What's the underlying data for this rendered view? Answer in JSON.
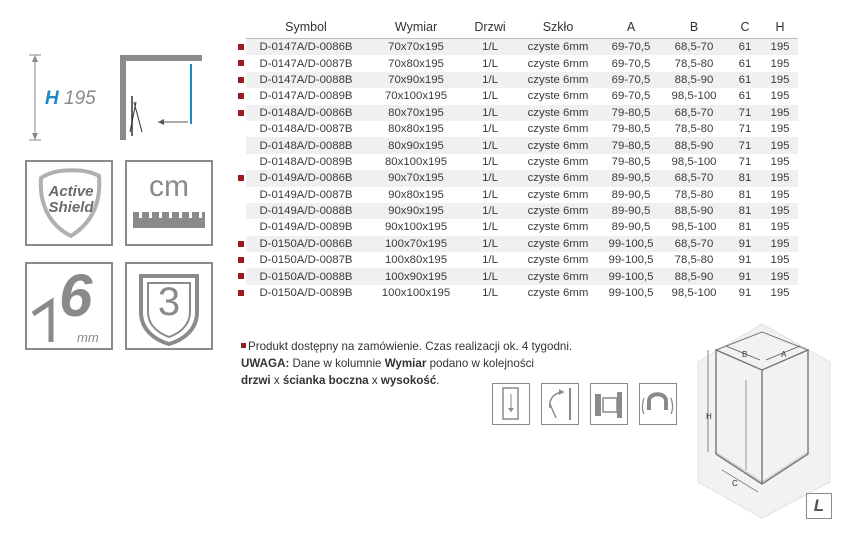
{
  "height_label": {
    "letter": "H",
    "value": "195"
  },
  "icons": {
    "active_shield": {
      "line1": "Active",
      "line2": "Shield"
    },
    "cm_label": "cm",
    "glass_thickness": {
      "number": "6",
      "unit": "mm"
    },
    "warranty_years": "3"
  },
  "table": {
    "headers": [
      "Symbol",
      "Wymiar",
      "Drzwi",
      "Szkło",
      "A",
      "B",
      "C",
      "H"
    ],
    "rows": [
      {
        "bullet": true,
        "cells": [
          "D-0147A/D-0086B",
          "70x70x195",
          "1/L",
          "czyste 6mm",
          "69-70,5",
          "68,5-70",
          "61",
          "195"
        ]
      },
      {
        "bullet": true,
        "cells": [
          "D-0147A/D-0087B",
          "70x80x195",
          "1/L",
          "czyste 6mm",
          "69-70,5",
          "78,5-80",
          "61",
          "195"
        ]
      },
      {
        "bullet": true,
        "cells": [
          "D-0147A/D-0088B",
          "70x90x195",
          "1/L",
          "czyste 6mm",
          "69-70,5",
          "88,5-90",
          "61",
          "195"
        ]
      },
      {
        "bullet": true,
        "cells": [
          "D-0147A/D-0089B",
          "70x100x195",
          "1/L",
          "czyste 6mm",
          "69-70,5",
          "98,5-100",
          "61",
          "195"
        ]
      },
      {
        "bullet": true,
        "cells": [
          "D-0148A/D-0086B",
          "80x70x195",
          "1/L",
          "czyste 6mm",
          "79-80,5",
          "68,5-70",
          "71",
          "195"
        ]
      },
      {
        "bullet": false,
        "cells": [
          "D-0148A/D-0087B",
          "80x80x195",
          "1/L",
          "czyste 6mm",
          "79-80,5",
          "78,5-80",
          "71",
          "195"
        ]
      },
      {
        "bullet": false,
        "cells": [
          "D-0148A/D-0088B",
          "80x90x195",
          "1/L",
          "czyste 6mm",
          "79-80,5",
          "88,5-90",
          "71",
          "195"
        ]
      },
      {
        "bullet": false,
        "cells": [
          "D-0148A/D-0089B",
          "80x100x195",
          "1/L",
          "czyste 6mm",
          "79-80,5",
          "98,5-100",
          "71",
          "195"
        ]
      },
      {
        "bullet": true,
        "cells": [
          "D-0149A/D-0086B",
          "90x70x195",
          "1/L",
          "czyste 6mm",
          "89-90,5",
          "68,5-70",
          "81",
          "195"
        ]
      },
      {
        "bullet": false,
        "cells": [
          "D-0149A/D-0087B",
          "90x80x195",
          "1/L",
          "czyste 6mm",
          "89-90,5",
          "78,5-80",
          "81",
          "195"
        ]
      },
      {
        "bullet": false,
        "cells": [
          "D-0149A/D-0088B",
          "90x90x195",
          "1/L",
          "czyste 6mm",
          "89-90,5",
          "88,5-90",
          "81",
          "195"
        ]
      },
      {
        "bullet": false,
        "cells": [
          "D-0149A/D-0089B",
          "90x100x195",
          "1/L",
          "czyste 6mm",
          "89-90,5",
          "98,5-100",
          "81",
          "195"
        ]
      },
      {
        "bullet": true,
        "cells": [
          "D-0150A/D-0086B",
          "100x70x195",
          "1/L",
          "czyste 6mm",
          "99-100,5",
          "68,5-70",
          "91",
          "195"
        ]
      },
      {
        "bullet": true,
        "cells": [
          "D-0150A/D-0087B",
          "100x80x195",
          "1/L",
          "czyste 6mm",
          "99-100,5",
          "78,5-80",
          "91",
          "195"
        ]
      },
      {
        "bullet": true,
        "cells": [
          "D-0150A/D-0088B",
          "100x90x195",
          "1/L",
          "czyste 6mm",
          "99-100,5",
          "88,5-90",
          "91",
          "195"
        ]
      },
      {
        "bullet": true,
        "cells": [
          "D-0150A/D-0089B",
          "100x100x195",
          "1/L",
          "czyste 6mm",
          "99-100,5",
          "98,5-100",
          "91",
          "195"
        ]
      }
    ]
  },
  "notes": {
    "line1": "Produkt dostępny na zamówienie. Czas realizacji ok. 4 tygodni.",
    "uwaga_label": "UWAGA:",
    "line2_text": " Dane w kolumnie ",
    "wymiar_bold": "Wymiar",
    "line2_end": " podano w kolejności",
    "drzwi": "drzwi",
    "x1": " x ",
    "scianka": "ścianka boczna",
    "x2": " x ",
    "wysokosc": "wysokość",
    "period": "."
  },
  "diagram": {
    "label_a": "A",
    "label_b": "B",
    "label_c": "C",
    "label_h": "H",
    "orientation": "L"
  },
  "colors": {
    "accent_red": "#9b1b22",
    "icon_gray": "#8a8a8a",
    "blue": "#1e88c7"
  }
}
